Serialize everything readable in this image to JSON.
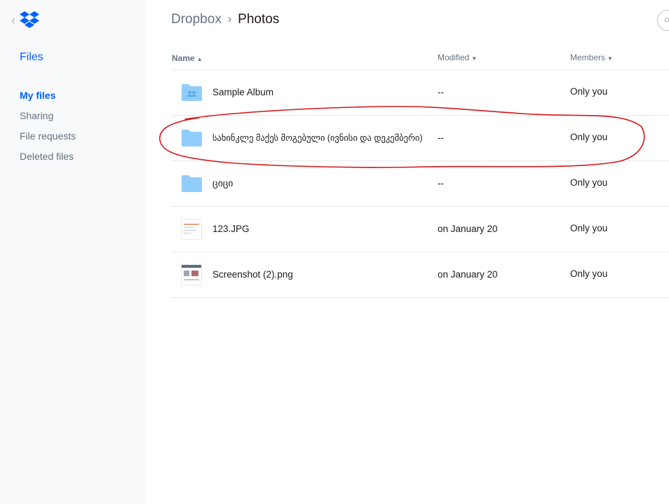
{
  "sidebar": {
    "logo_icon": "dropbox-logo",
    "back_icon": "chevron-left-icon",
    "section_title": "Files",
    "items": [
      {
        "label": "My files",
        "active": true
      },
      {
        "label": "Sharing",
        "active": false
      },
      {
        "label": "File requests",
        "active": false
      },
      {
        "label": "Deleted files",
        "active": false
      }
    ]
  },
  "breadcrumb": {
    "root": "Dropbox",
    "separator": "›",
    "current": "Photos"
  },
  "table": {
    "headers": {
      "name": "Name",
      "name_sort": "▲",
      "modified": "Modified",
      "modified_sort": "▼",
      "members": "Members",
      "members_sort": "▼"
    },
    "rows": [
      {
        "type": "shared-folder",
        "name": "Sample Album",
        "modified": "--",
        "members": "Only you"
      },
      {
        "type": "folder",
        "name": "სახინკლე მაქეს მოგებული (ივნისი და დეკემბერი)",
        "modified": "--",
        "members": "Only you"
      },
      {
        "type": "folder",
        "name": "ციცი",
        "modified": "--",
        "members": "Only you"
      },
      {
        "type": "image",
        "name": "123.JPG",
        "modified": "on January 20",
        "members": "Only you"
      },
      {
        "type": "image",
        "name": "Screenshot (2).png",
        "modified": "on January 20",
        "members": "Only you"
      }
    ]
  },
  "colors": {
    "accent": "#0061fe",
    "folder": "#90cdfb",
    "annotation": "#d4161b"
  }
}
